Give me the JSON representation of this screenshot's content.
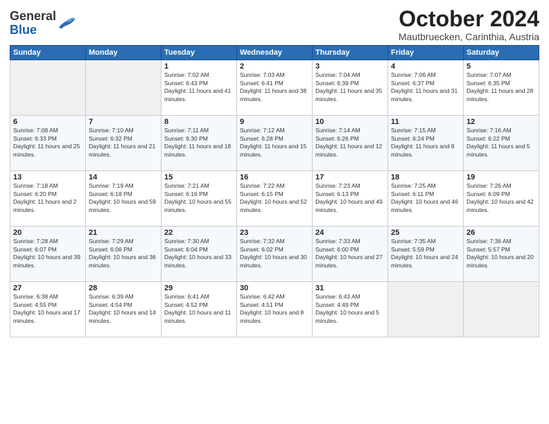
{
  "header": {
    "logo_general": "General",
    "logo_blue": "Blue",
    "month_title": "October 2024",
    "location": "Mautbruecken, Carinthia, Austria"
  },
  "weekdays": [
    "Sunday",
    "Monday",
    "Tuesday",
    "Wednesday",
    "Thursday",
    "Friday",
    "Saturday"
  ],
  "weeks": [
    [
      {
        "day": "",
        "info": ""
      },
      {
        "day": "",
        "info": ""
      },
      {
        "day": "1",
        "info": "Sunrise: 7:02 AM\nSunset: 6:43 PM\nDaylight: 11 hours and 41 minutes."
      },
      {
        "day": "2",
        "info": "Sunrise: 7:03 AM\nSunset: 6:41 PM\nDaylight: 11 hours and 38 minutes."
      },
      {
        "day": "3",
        "info": "Sunrise: 7:04 AM\nSunset: 6:39 PM\nDaylight: 11 hours and 35 minutes."
      },
      {
        "day": "4",
        "info": "Sunrise: 7:06 AM\nSunset: 6:37 PM\nDaylight: 11 hours and 31 minutes."
      },
      {
        "day": "5",
        "info": "Sunrise: 7:07 AM\nSunset: 6:35 PM\nDaylight: 11 hours and 28 minutes."
      }
    ],
    [
      {
        "day": "6",
        "info": "Sunrise: 7:08 AM\nSunset: 6:33 PM\nDaylight: 11 hours and 25 minutes."
      },
      {
        "day": "7",
        "info": "Sunrise: 7:10 AM\nSunset: 6:32 PM\nDaylight: 11 hours and 21 minutes."
      },
      {
        "day": "8",
        "info": "Sunrise: 7:11 AM\nSunset: 6:30 PM\nDaylight: 11 hours and 18 minutes."
      },
      {
        "day": "9",
        "info": "Sunrise: 7:12 AM\nSunset: 6:28 PM\nDaylight: 11 hours and 15 minutes."
      },
      {
        "day": "10",
        "info": "Sunrise: 7:14 AM\nSunset: 6:26 PM\nDaylight: 11 hours and 12 minutes."
      },
      {
        "day": "11",
        "info": "Sunrise: 7:15 AM\nSunset: 6:24 PM\nDaylight: 11 hours and 8 minutes."
      },
      {
        "day": "12",
        "info": "Sunrise: 7:16 AM\nSunset: 6:22 PM\nDaylight: 11 hours and 5 minutes."
      }
    ],
    [
      {
        "day": "13",
        "info": "Sunrise: 7:18 AM\nSunset: 6:20 PM\nDaylight: 11 hours and 2 minutes."
      },
      {
        "day": "14",
        "info": "Sunrise: 7:19 AM\nSunset: 6:18 PM\nDaylight: 10 hours and 59 minutes."
      },
      {
        "day": "15",
        "info": "Sunrise: 7:21 AM\nSunset: 6:16 PM\nDaylight: 10 hours and 55 minutes."
      },
      {
        "day": "16",
        "info": "Sunrise: 7:22 AM\nSunset: 6:15 PM\nDaylight: 10 hours and 52 minutes."
      },
      {
        "day": "17",
        "info": "Sunrise: 7:23 AM\nSunset: 6:13 PM\nDaylight: 10 hours and 49 minutes."
      },
      {
        "day": "18",
        "info": "Sunrise: 7:25 AM\nSunset: 6:11 PM\nDaylight: 10 hours and 46 minutes."
      },
      {
        "day": "19",
        "info": "Sunrise: 7:26 AM\nSunset: 6:09 PM\nDaylight: 10 hours and 42 minutes."
      }
    ],
    [
      {
        "day": "20",
        "info": "Sunrise: 7:28 AM\nSunset: 6:07 PM\nDaylight: 10 hours and 39 minutes."
      },
      {
        "day": "21",
        "info": "Sunrise: 7:29 AM\nSunset: 6:06 PM\nDaylight: 10 hours and 36 minutes."
      },
      {
        "day": "22",
        "info": "Sunrise: 7:30 AM\nSunset: 6:04 PM\nDaylight: 10 hours and 33 minutes."
      },
      {
        "day": "23",
        "info": "Sunrise: 7:32 AM\nSunset: 6:02 PM\nDaylight: 10 hours and 30 minutes."
      },
      {
        "day": "24",
        "info": "Sunrise: 7:33 AM\nSunset: 6:00 PM\nDaylight: 10 hours and 27 minutes."
      },
      {
        "day": "25",
        "info": "Sunrise: 7:35 AM\nSunset: 5:59 PM\nDaylight: 10 hours and 24 minutes."
      },
      {
        "day": "26",
        "info": "Sunrise: 7:36 AM\nSunset: 5:57 PM\nDaylight: 10 hours and 20 minutes."
      }
    ],
    [
      {
        "day": "27",
        "info": "Sunrise: 6:38 AM\nSunset: 4:55 PM\nDaylight: 10 hours and 17 minutes."
      },
      {
        "day": "28",
        "info": "Sunrise: 6:39 AM\nSunset: 4:54 PM\nDaylight: 10 hours and 14 minutes."
      },
      {
        "day": "29",
        "info": "Sunrise: 6:41 AM\nSunset: 4:52 PM\nDaylight: 10 hours and 11 minutes."
      },
      {
        "day": "30",
        "info": "Sunrise: 6:42 AM\nSunset: 4:51 PM\nDaylight: 10 hours and 8 minutes."
      },
      {
        "day": "31",
        "info": "Sunrise: 6:43 AM\nSunset: 4:49 PM\nDaylight: 10 hours and 5 minutes."
      },
      {
        "day": "",
        "info": ""
      },
      {
        "day": "",
        "info": ""
      }
    ]
  ]
}
